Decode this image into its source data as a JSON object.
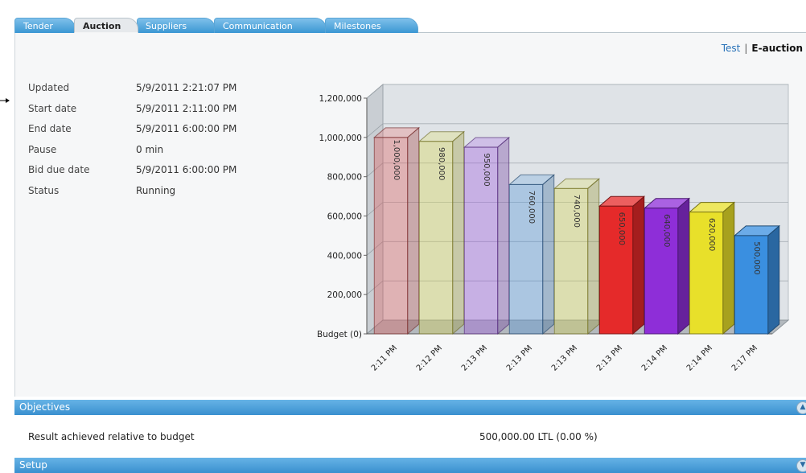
{
  "tabs": [
    {
      "label": "Tender",
      "active": false
    },
    {
      "label": "Auction",
      "active": true
    },
    {
      "label": "Suppliers",
      "active": false
    },
    {
      "label": "Communication",
      "active": false
    },
    {
      "label": "Milestones",
      "active": false
    }
  ],
  "header_links": {
    "test": "Test",
    "separator": "|",
    "current": "E-auction"
  },
  "auction_info": [
    {
      "key": "Updated",
      "value": "5/9/2011 2:21:07 PM"
    },
    {
      "key": "Start date",
      "value": "5/9/2011 2:11:00 PM"
    },
    {
      "key": "End date",
      "value": "5/9/2011 6:00:00 PM"
    },
    {
      "key": "Pause",
      "value": "0 min"
    },
    {
      "key": "Bid due date",
      "value": "5/9/2011 6:00:00 PM"
    },
    {
      "key": "Status",
      "value": "Running"
    }
  ],
  "chart_data": {
    "type": "bar",
    "categories": [
      "2:11 PM",
      "2:12 PM",
      "2:13 PM",
      "2:13 PM",
      "2:13 PM",
      "2:13 PM",
      "2:14 PM",
      "2:14 PM",
      "2:17 PM"
    ],
    "values": [
      1000000,
      980000,
      950000,
      760000,
      740000,
      650000,
      640000,
      620000,
      500000
    ],
    "value_labels": [
      "1,000,000",
      "980,000",
      "950,000",
      "760,000",
      "740,000",
      "650,000",
      "640,000",
      "620,000",
      "500,000"
    ],
    "bar_colors": [
      "#e05555",
      "#d6d44a",
      "#9a4fe0",
      "#4a8fd6",
      "#d6d44a",
      "#e52a2a",
      "#8e2ed8",
      "#e8e02a",
      "#3a8fe0"
    ],
    "bar_opacity": [
      0.35,
      0.35,
      0.35,
      0.35,
      0.35,
      1,
      1,
      1,
      1
    ],
    "y_ticks": [
      "Budget (0)",
      "200,000",
      "400,000",
      "600,000",
      "800,000",
      "1,000,000",
      "1,200,000"
    ],
    "ylim": [
      0,
      1200000
    ],
    "grid": true
  },
  "objectives": {
    "title": "Objectives",
    "label": "Result achieved relative to budget",
    "value": "500,000.00 LTL (0.00 %)"
  },
  "setup": {
    "title": "Setup"
  }
}
